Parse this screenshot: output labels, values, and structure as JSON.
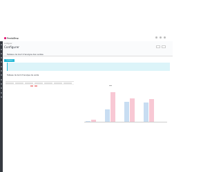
{
  "brand": {
    "name": "PrestaShop",
    "accent": "#df0067"
  },
  "header": {
    "breadcrumb": "Configurer",
    "title": "Configurer",
    "buttons": [
      "",
      ""
    ]
  },
  "panel": {
    "title": "Tableau de bord d'analyse des ventes"
  },
  "tabs": [
    "Configurer",
    "",
    ""
  ],
  "info": {
    "lines": [
      "",
      "",
      ""
    ]
  },
  "section": {
    "title": "Tableau de bord d'analyse de vente"
  },
  "table": {
    "headers": [
      "ID",
      "",
      "",
      "",
      "",
      "",
      ""
    ],
    "row": {
      "col1": "",
      "col2": ""
    }
  },
  "chart_data": {
    "type": "bar",
    "title": "",
    "categories": [
      "",
      "",
      "",
      ""
    ],
    "series": [
      {
        "values": [
          2,
          24,
          40,
          38
        ],
        "color": "#c8ddf2"
      },
      {
        "values": [
          4,
          58,
          46,
          45
        ],
        "color": "#f8c8d4"
      }
    ],
    "ylim": [
      0,
      60
    ],
    "xlabel": "",
    "ylabel": ""
  }
}
